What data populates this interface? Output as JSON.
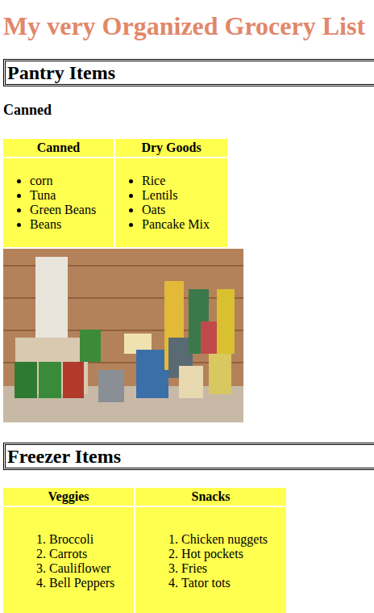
{
  "title": "My very Organized Grocery List",
  "sections": [
    {
      "heading": "Pantry Items",
      "subheading": "Canned",
      "kind": "bullet",
      "photo": true,
      "columns": [
        {
          "header": "Canned",
          "items": [
            "corn",
            "Tuna",
            "Green Beans",
            "Beans"
          ]
        },
        {
          "header": "Dry Goods",
          "items": [
            "Rice",
            "Lentils",
            "Oats",
            "Pancake Mix"
          ]
        }
      ]
    },
    {
      "heading": "Freezer Items",
      "kind": "numbered",
      "photo": false,
      "columns": [
        {
          "header": "Veggies",
          "items": [
            "Broccoli",
            "Carrots",
            "Cauliflower",
            "Bell Peppers"
          ]
        },
        {
          "header": "Snacks",
          "items": [
            "Chicken nuggets",
            "Hot pockets",
            "Fries",
            "Tator tots"
          ]
        }
      ]
    }
  ]
}
